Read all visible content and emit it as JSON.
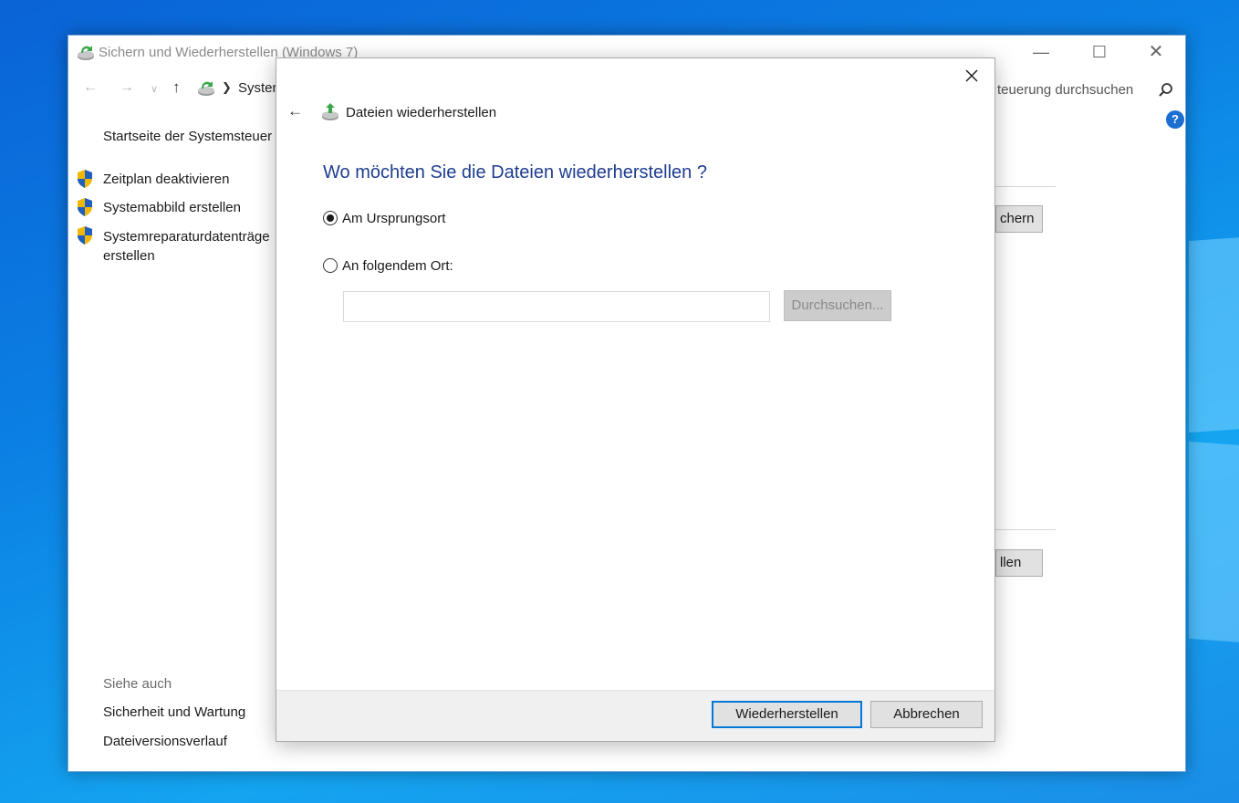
{
  "background_window": {
    "title": "Sichern und Wiederherstellen (Windows 7)",
    "title_icon": "backup-restore-icon",
    "address": {
      "breadcrumb": "Syster",
      "search_text": "teuerung durchsuchen"
    },
    "sidebar": {
      "home_link": "Startseite der Systemsteuer",
      "links": [
        {
          "label": "Zeitplan deaktivieren",
          "icon": "uac-shield-icon"
        },
        {
          "label": "Systemabbild erstellen",
          "icon": "uac-shield-icon"
        },
        {
          "label": "Systemreparaturdatenträge",
          "label_line2": "erstellen",
          "icon": "uac-shield-icon"
        }
      ],
      "see_also": {
        "heading": "Siehe auch",
        "links": [
          "Sicherheit und Wartung",
          "Dateiversionsverlauf"
        ]
      }
    },
    "content": {
      "button_top": "chern",
      "button_bottom": "llen"
    }
  },
  "dialog": {
    "title": "Dateien wiederherstellen",
    "title_icon": "file-restore-icon",
    "heading": "Wo möchten Sie die Dateien wiederherstellen ?",
    "options": [
      {
        "label": "Am Ursprungsort",
        "checked": true
      },
      {
        "label": "An folgendem Ort:",
        "checked": false
      }
    ],
    "path_value": "",
    "browse_label": "Durchsuchen...",
    "restore_label": "Wiederherstellen",
    "cancel_label": "Abbrechen"
  },
  "colors": {
    "heading_blue": "#1e3d8f",
    "accent_blue": "#0078d7",
    "desktop_blue": "#0b7fe3"
  }
}
